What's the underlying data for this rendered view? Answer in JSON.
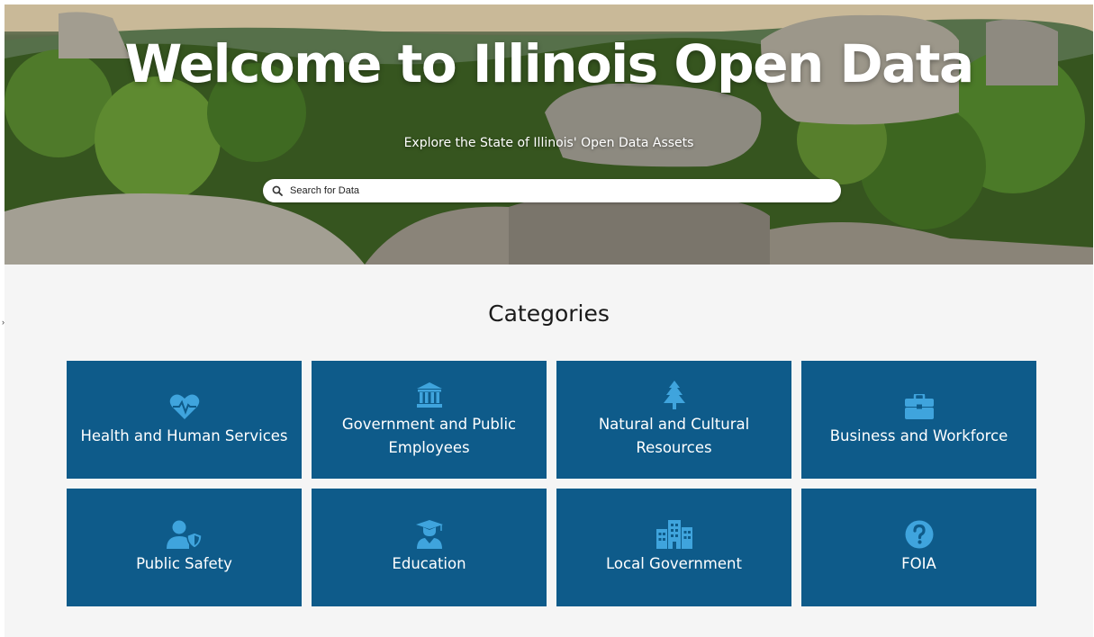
{
  "hero": {
    "title": "Welcome to Illinois Open Data",
    "subtitle": "Explore the State of Illinois' Open Data Assets",
    "search": {
      "placeholder": "Search for Data",
      "icon": "search-icon"
    }
  },
  "categories": {
    "title": "Categories",
    "items": [
      {
        "label": "Health and Human Services",
        "icon": "heart-pulse-icon"
      },
      {
        "label": "Government and Public Employees",
        "icon": "government-building-icon"
      },
      {
        "label": "Natural and Cultural Resources",
        "icon": "pine-tree-icon"
      },
      {
        "label": "Business and Workforce",
        "icon": "briefcase-icon"
      },
      {
        "label": "Public Safety",
        "icon": "user-shield-icon"
      },
      {
        "label": "Education",
        "icon": "graduate-icon"
      },
      {
        "label": "Local Government",
        "icon": "city-buildings-icon"
      },
      {
        "label": "FOIA",
        "icon": "question-circle-icon"
      }
    ]
  },
  "colors": {
    "tile_background": "#0e5b8a",
    "icon_color": "#3fa4dd",
    "page_background": "#f5f5f5"
  }
}
